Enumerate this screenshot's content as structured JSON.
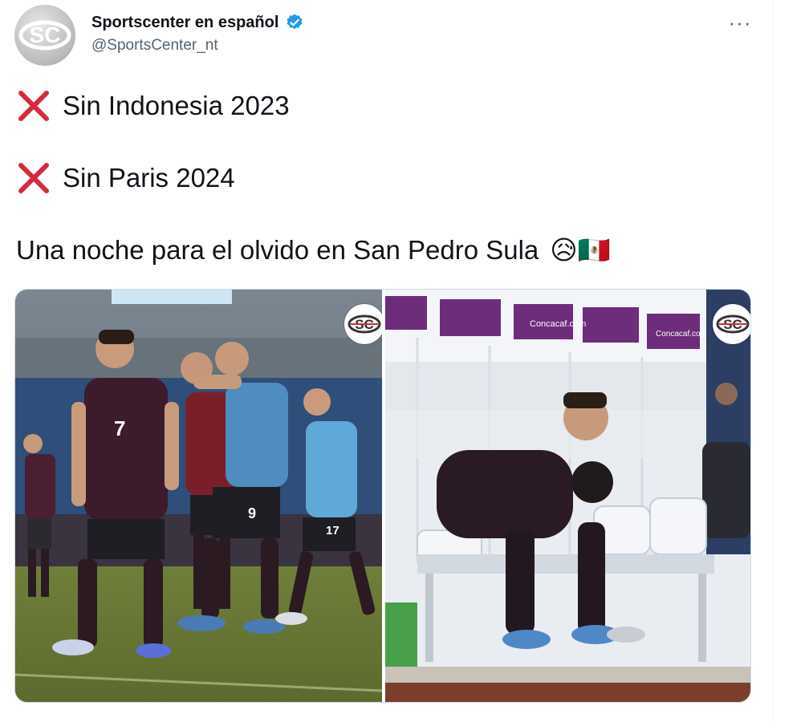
{
  "tweet": {
    "author": {
      "display_name": "Sportscenter en español",
      "handle": "@SportsCenter_nt",
      "avatar_icon": "sportscenter-logo",
      "verified_icon": "verified-badge-icon",
      "avatar_text": "SC"
    },
    "more_label": "···",
    "lines": [
      {
        "icon": "cross-mark-icon",
        "text": "Sin Indonesia 2023"
      },
      {
        "icon": "cross-mark-icon",
        "text": "Sin Paris 2024"
      }
    ],
    "caption": "Una noche para el olvido en San Pedro Sula",
    "caption_emojis": "😥🇲🇽",
    "media": {
      "left_photo": {
        "watermark": "SC",
        "jersey_numbers": [
          "7",
          "9",
          "17"
        ]
      },
      "right_photo": {
        "watermark": "SC",
        "sponsor_text": "Concacaf.com"
      }
    }
  },
  "colors": {
    "text": "#0f1419",
    "secondary": "#536471",
    "verified": "#1d9bf0",
    "cross": "#d62a3a",
    "border": "#cfd9de"
  }
}
